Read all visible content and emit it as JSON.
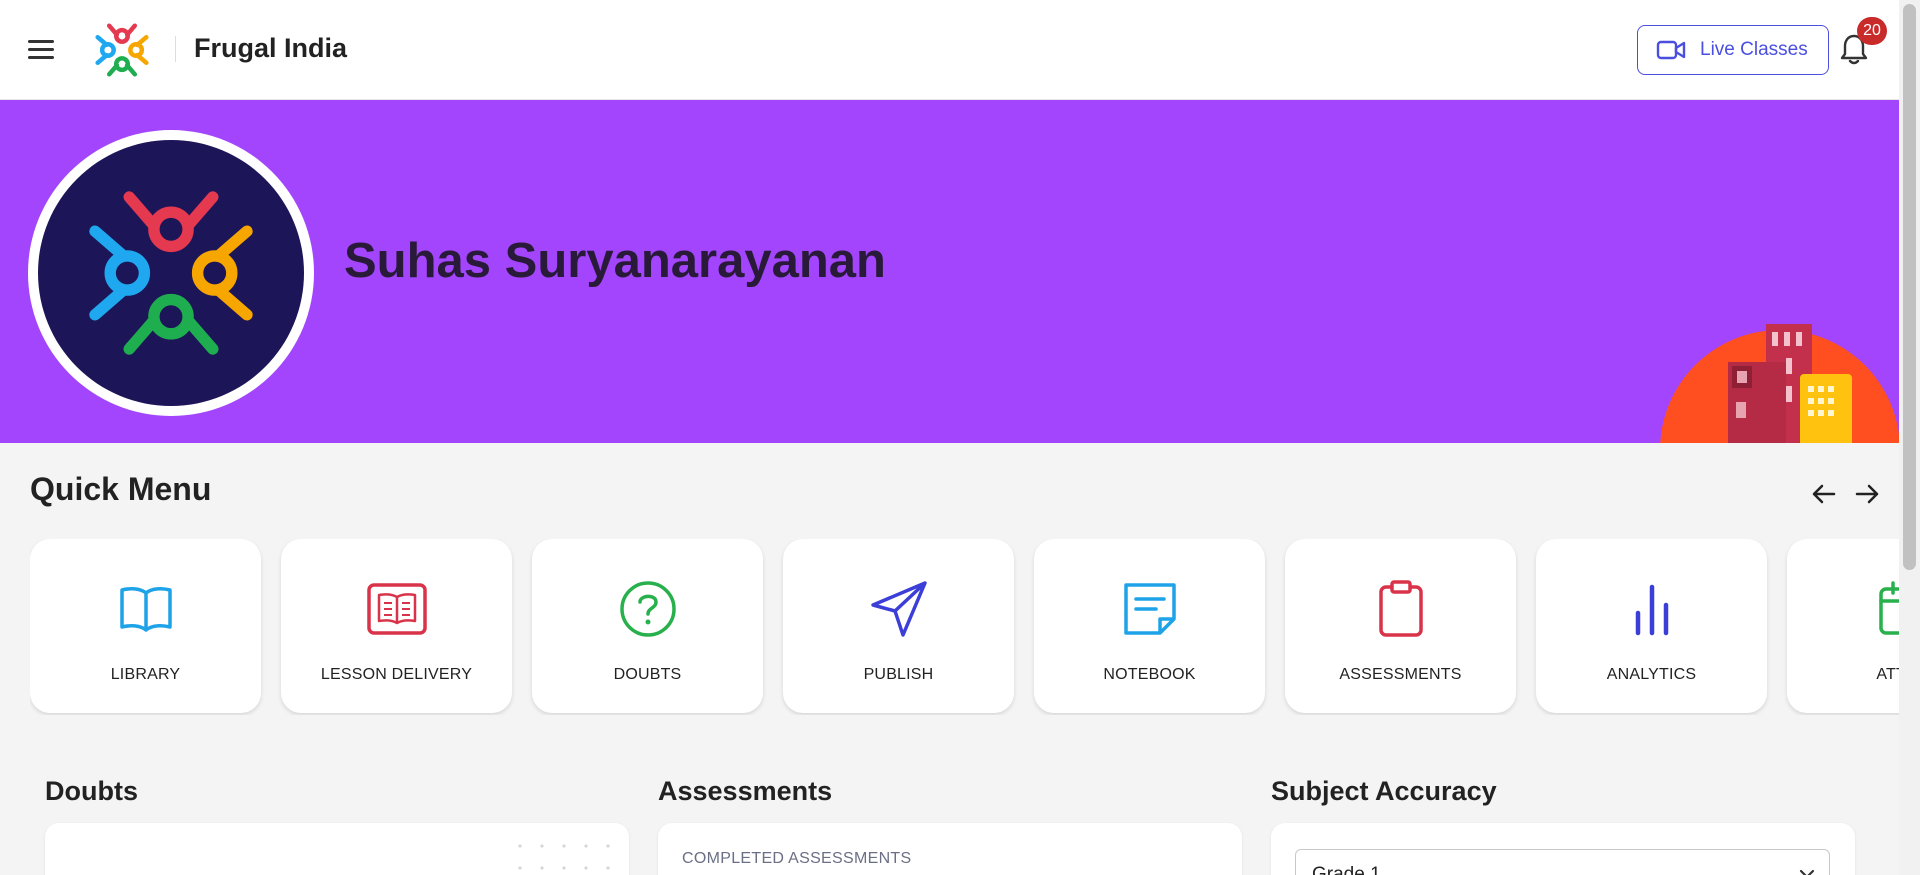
{
  "header": {
    "brand": "Frugal India",
    "live_classes_label": "Live Classes",
    "notification_count": "20"
  },
  "banner": {
    "user_name": "Suhas Suryanarayanan"
  },
  "quick_menu": {
    "title": "Quick Menu",
    "items": [
      {
        "label": "LIBRARY",
        "icon": "book-icon",
        "color": "#1fa3e8"
      },
      {
        "label": "LESSON DELIVERY",
        "icon": "open-book-icon",
        "color": "#d9334a"
      },
      {
        "label": "DOUBTS",
        "icon": "question-circle-icon",
        "color": "#27b04b"
      },
      {
        "label": "PUBLISH",
        "icon": "send-icon",
        "color": "#3b3fd8"
      },
      {
        "label": "NOTEBOOK",
        "icon": "note-icon",
        "color": "#1fa3e8"
      },
      {
        "label": "ASSESSMENTS",
        "icon": "clipboard-icon",
        "color": "#d9334a"
      },
      {
        "label": "ANALYTICS",
        "icon": "bar-chart-icon",
        "color": "#3b3fd8"
      },
      {
        "label": "ATTEN",
        "icon": "calendar-icon",
        "color": "#27b04b"
      }
    ]
  },
  "sections": {
    "doubts_title": "Doubts",
    "assessments_title": "Assessments",
    "completed_label": "COMPLETED ASSESSMENTS",
    "subject_accuracy_title": "Subject Accuracy",
    "grade_select_value": "Grade 1"
  },
  "colors": {
    "banner": "#a345fc",
    "accent": "#4b4fe0",
    "badge": "#c92a2a"
  }
}
